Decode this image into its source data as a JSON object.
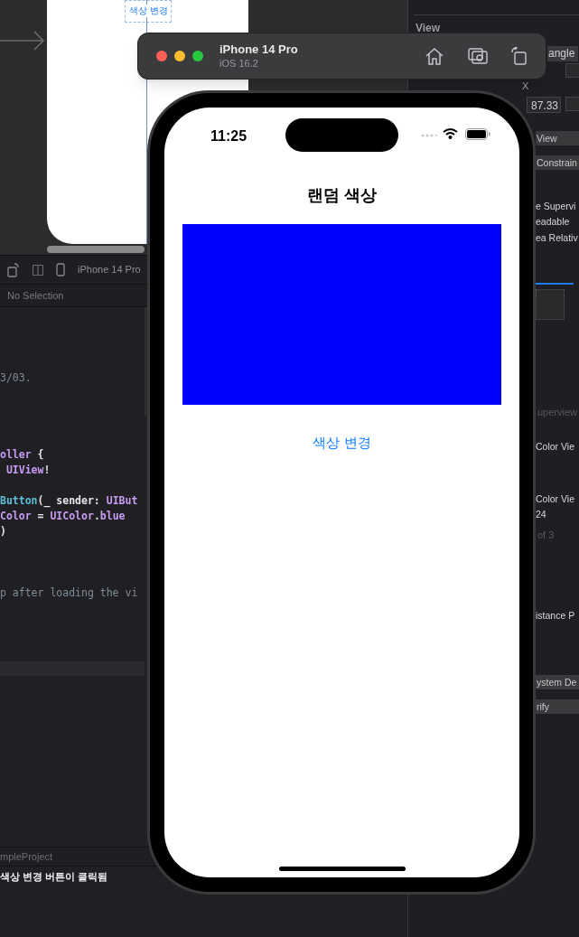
{
  "editor": {
    "storyboard": {
      "scene_button_label": "색상 변경"
    },
    "toolbar": {
      "device": "iPhone 14 Pro"
    },
    "jump_bar": {
      "selection": "No Selection"
    },
    "code_lines": [
      {
        "segments": [
          {
            "text": "3/03.",
            "kind": "comment"
          }
        ]
      },
      {
        "segments": [
          {
            "text": "oller",
            "kind": "type"
          },
          {
            "text": " {",
            "kind": "plain"
          }
        ]
      },
      {
        "segments": [
          {
            "text": " UIView",
            "kind": "type"
          },
          {
            "text": "!",
            "kind": "plain"
          }
        ]
      },
      {
        "segments": [
          {
            "text": "Button",
            "kind": "func"
          },
          {
            "text": "(_ sender: ",
            "kind": "plain"
          },
          {
            "text": "UIBut",
            "kind": "type"
          }
        ]
      },
      {
        "segments": [
          {
            "text": "Color",
            "kind": "type"
          },
          {
            "text": " = ",
            "kind": "plain"
          },
          {
            "text": "UIColor",
            "kind": "type"
          },
          {
            "text": ".",
            "kind": "plain"
          },
          {
            "text": "blue",
            "kind": "type"
          }
        ]
      },
      {
        "segments": [
          {
            "text": ")",
            "kind": "plain"
          }
        ]
      },
      {
        "segments": [
          {
            "text": "p after loading the vi",
            "kind": "comment"
          }
        ]
      }
    ],
    "debug_bar": {
      "target": "mpleProject"
    },
    "console": {
      "lines": [
        "색상 변경 버튼이 클릭됨"
      ]
    }
  },
  "inspector": {
    "items": [
      {
        "kind": "header",
        "text": "View"
      },
      {
        "kind": "popup",
        "text": "angle"
      },
      {
        "kind": "label",
        "text": "X"
      },
      {
        "kind": "field",
        "text": "87.33"
      },
      {
        "kind": "bar",
        "text": "View"
      },
      {
        "kind": "bar",
        "text": "Constrain"
      },
      {
        "kind": "text",
        "text": "e Supervi"
      },
      {
        "kind": "text",
        "text": "eadable"
      },
      {
        "kind": "text",
        "text": "ea Relativ"
      },
      {
        "kind": "dim",
        "text": "uperview"
      },
      {
        "kind": "text",
        "text": "Color Vie"
      },
      {
        "kind": "text",
        "text": "Color Vie"
      },
      {
        "kind": "text",
        "text": "24"
      },
      {
        "kind": "dim",
        "text": "of 3"
      },
      {
        "kind": "text",
        "text": "istance P"
      },
      {
        "kind": "bar",
        "text": "ystem De"
      },
      {
        "kind": "bar",
        "text": "rify"
      }
    ]
  },
  "simulator": {
    "title": "iPhone 14 Pro",
    "subtitle": "iOS 16.2",
    "screen": {
      "time": "11:25",
      "nav_title": "랜덤 색상",
      "button": "색상 변경"
    }
  }
}
